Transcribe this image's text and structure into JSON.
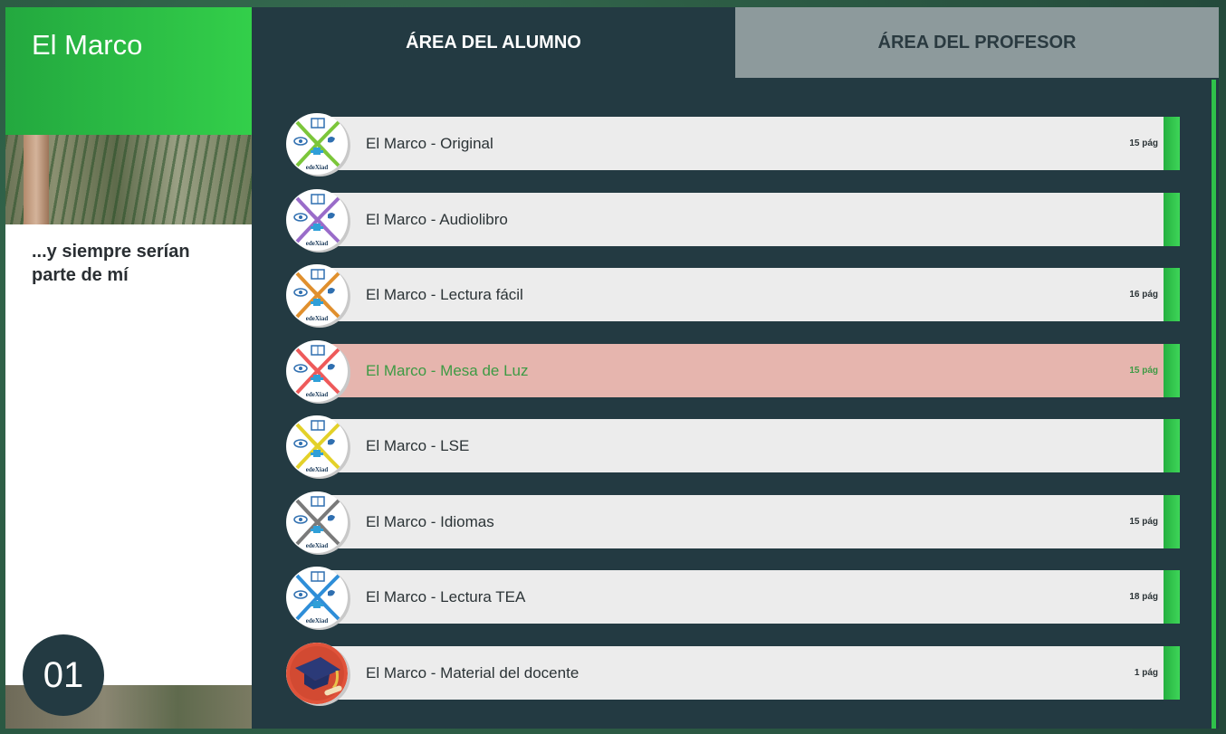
{
  "app": {
    "title": "El Marco",
    "subtitle": "...y siempre serían parte de mí",
    "number": "01"
  },
  "tabs": [
    {
      "label": "ÁREA DEL ALUMNO",
      "active": true
    },
    {
      "label": "ÁREA DEL PROFESOR",
      "active": false
    }
  ],
  "items": [
    {
      "label": "El Marco - Original",
      "pages": "15 pág",
      "icon": "edexiad-original-icon",
      "color": "#7cc63a",
      "active": false
    },
    {
      "label": "El Marco - Audiolibro",
      "pages": "",
      "icon": "edexiad-audiolibro-icon",
      "color": "#9a6cc9",
      "active": false
    },
    {
      "label": "El Marco - Lectura fácil",
      "pages": "16 pág",
      "icon": "edexiad-lectura-facil-icon",
      "color": "#e0902e",
      "active": false
    },
    {
      "label": "El Marco - Mesa de Luz",
      "pages": "15 pág",
      "icon": "edexiad-mesa-de-luz-icon",
      "color": "#ee5a5a",
      "active": true
    },
    {
      "label": "El Marco - LSE",
      "pages": "",
      "icon": "edexiad-lse-icon",
      "color": "#e3d12a",
      "active": false
    },
    {
      "label": "El Marco - Idiomas",
      "pages": "15 pág",
      "icon": "edexiad-idiomas-icon",
      "color": "#7a7a7a",
      "active": false
    },
    {
      "label": "El Marco - Lectura TEA",
      "pages": "18 pág",
      "icon": "edexiad-lectura-tea-icon",
      "color": "#2f8ed8",
      "active": false
    },
    {
      "label": "El Marco - Material del docente",
      "pages": "1 pág",
      "icon": "graduation-cap-icon",
      "color": "#e0533a",
      "active": false
    }
  ],
  "colors": {
    "accent_green": "#33cf4a",
    "panel_dark": "#233a42",
    "tab_inactive": "#8d9a9c",
    "row_bg": "#ececec",
    "row_active_bg": "#e6b5ae"
  }
}
